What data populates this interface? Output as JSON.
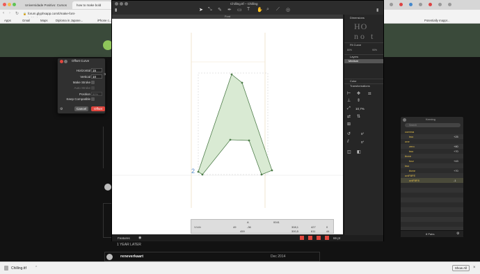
{
  "browser": {
    "tabs": [
      {
        "label": "Universidade Positivo: Cursos"
      },
      {
        "label": "how to make bold"
      }
    ],
    "url": "forum.glyphsapp.com/t/make-font-bolder/1106",
    "bookmarks": [
      "Apps",
      "Gmail",
      "Maps",
      "Diploma in Japane...",
      "iPhone c...",
      "Potentially mappr..."
    ]
  },
  "forum": {
    "year_later": "1 YEAR LATER",
    "user": "reneverkaart",
    "date": "Dec 2014"
  },
  "glyphs": {
    "window_title": "Chilling.ttf – Chilling",
    "font_tab": "Font",
    "bottom": {
      "features": "Features",
      "zoom": "66 pt"
    },
    "info": {
      "glyph_name": "A",
      "unicode": "0041",
      "width_label": "Width",
      "lsb": "49",
      "rsb": "-36",
      "width": "459",
      "x": "308,1",
      "y": "300,5",
      "w": "427",
      "h": "611",
      "nodes": "0",
      "count": "44"
    },
    "panel": {
      "dimensions": "Dimensions",
      "fit_curve": "Fit Curve",
      "fit_min": "80%",
      "fit_max": "90%",
      "layers": "Layers",
      "layer_name": "Medium",
      "color": "Color",
      "transformations": "Transformations",
      "scale_pct": "10,7%",
      "rotate": "0°",
      "slant": "0°"
    }
  },
  "dialog": {
    "title": "Offset Curve",
    "horizontal_label": "Horizontal",
    "horizontal_value": "15",
    "vertical_label": "Vertical",
    "vertical_value": "10",
    "make_stroke": "Make Stroke",
    "auto_stroke": "Auto Stroke",
    "position_label": "Position",
    "position_value": "50%",
    "keep_compatible": "Keep Compatible",
    "cancel": "Cancel",
    "ok": "Offset"
  },
  "kerning": {
    "title": "Kerning",
    "search": "Search",
    "rows": [
      {
        "name": "comma",
        "value": "",
        "group": true
      },
      {
        "name": "two",
        "value": "+25",
        "group": false
      },
      {
        "name": "one",
        "value": "",
        "group": true
      },
      {
        "name": "zero",
        "value": "+80",
        "group": false
      },
      {
        "name": "two",
        "value": "+70",
        "group": false
      },
      {
        "name": "three",
        "value": "",
        "group": true
      },
      {
        "name": "four",
        "value": "+43",
        "group": false
      },
      {
        "name": "two",
        "value": "",
        "group": true
      },
      {
        "name": "three",
        "value": "+70",
        "group": false
      },
      {
        "name": "uniF8FE",
        "value": "",
        "group": true
      },
      {
        "name": "uniF8F8",
        "value": "-1",
        "group": false
      }
    ],
    "pairs": "8 Pairs"
  },
  "download": {
    "file": "Chilling.ttf",
    "show_all": "Show All"
  },
  "colors": {
    "accent_red": "#e0463e",
    "glyph_fill": "#d9ead3",
    "glyph_stroke": "#4e7d4a",
    "kern_group": "#e8c34a"
  }
}
